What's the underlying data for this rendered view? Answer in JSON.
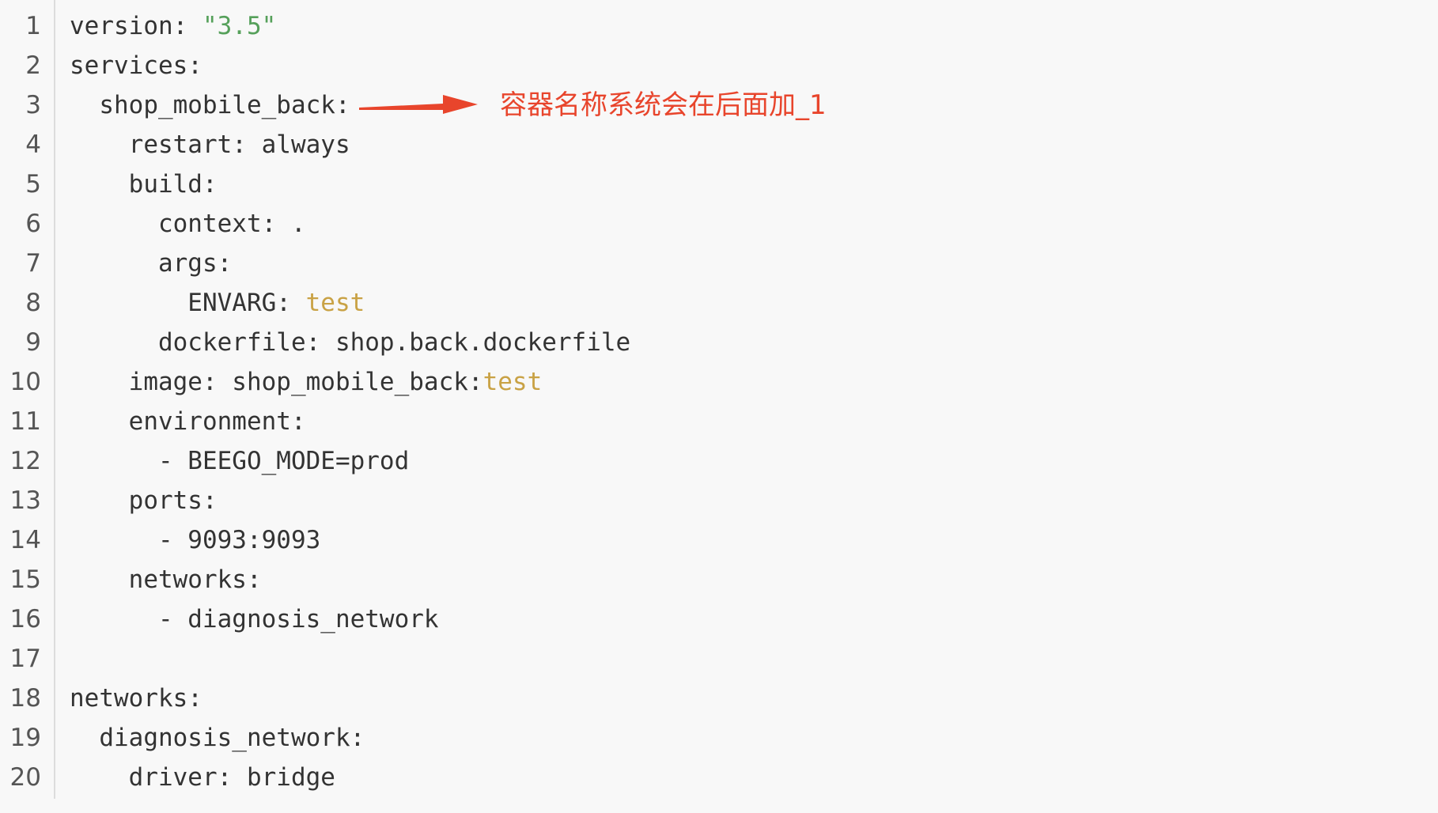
{
  "editor": {
    "gutter": [
      "1",
      "2",
      "3",
      "4",
      "5",
      "6",
      "7",
      "8",
      "9",
      "10",
      "11",
      "12",
      "13",
      "14",
      "15",
      "16",
      "17",
      "18",
      "19",
      "20"
    ],
    "lines": [
      {
        "segments": [
          {
            "text": "version: ",
            "type": "plain"
          },
          {
            "text": "\"3.5\"",
            "type": "str"
          }
        ]
      },
      {
        "segments": [
          {
            "text": "services:",
            "type": "plain"
          }
        ]
      },
      {
        "segments": [
          {
            "text": "  shop_mobile_back:",
            "type": "plain"
          }
        ]
      },
      {
        "segments": [
          {
            "text": "    restart: always",
            "type": "plain"
          }
        ]
      },
      {
        "segments": [
          {
            "text": "    build:",
            "type": "plain"
          }
        ]
      },
      {
        "segments": [
          {
            "text": "      context: .",
            "type": "plain"
          }
        ]
      },
      {
        "segments": [
          {
            "text": "      args:",
            "type": "plain"
          }
        ]
      },
      {
        "segments": [
          {
            "text": "        ENVARG: ",
            "type": "plain"
          },
          {
            "text": "test",
            "type": "val"
          }
        ]
      },
      {
        "segments": [
          {
            "text": "      dockerfile: shop.back.dockerfile",
            "type": "plain"
          }
        ]
      },
      {
        "segments": [
          {
            "text": "    image: shop_mobile_back:",
            "type": "plain"
          },
          {
            "text": "test",
            "type": "val"
          }
        ]
      },
      {
        "segments": [
          {
            "text": "    environment:",
            "type": "plain"
          }
        ]
      },
      {
        "segments": [
          {
            "text": "      - BEEGO_MODE=prod",
            "type": "plain"
          }
        ]
      },
      {
        "segments": [
          {
            "text": "    ports:",
            "type": "plain"
          }
        ]
      },
      {
        "segments": [
          {
            "text": "      - 9093:9093",
            "type": "plain"
          }
        ]
      },
      {
        "segments": [
          {
            "text": "    networks:",
            "type": "plain"
          }
        ]
      },
      {
        "segments": [
          {
            "text": "      - diagnosis_network",
            "type": "plain"
          }
        ]
      },
      {
        "segments": [
          {
            "text": "",
            "type": "plain"
          }
        ]
      },
      {
        "segments": [
          {
            "text": "networks:",
            "type": "plain"
          }
        ]
      },
      {
        "segments": [
          {
            "text": "  diagnosis_network:",
            "type": "plain"
          }
        ]
      },
      {
        "segments": [
          {
            "text": "    driver: bridge",
            "type": "plain"
          }
        ]
      }
    ]
  },
  "annotation": {
    "text": "容器名称系统会在后面加_1",
    "color": "#e8452c"
  },
  "colors": {
    "background": "#f8f8f8",
    "text": "#333333",
    "string": "#55a05a",
    "value": "#c9a245",
    "gutter_text": "#555555",
    "arrow": "#e8452c"
  }
}
